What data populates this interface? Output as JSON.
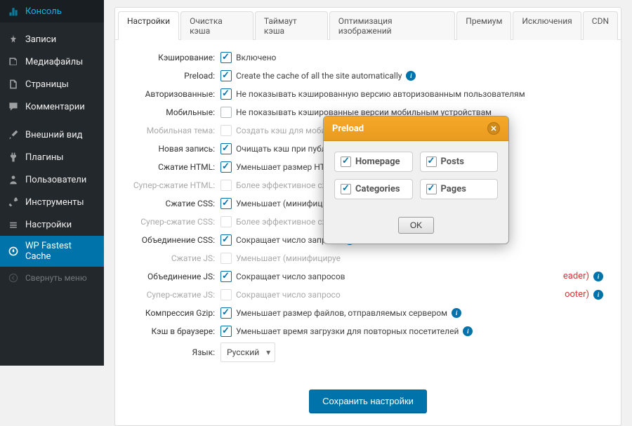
{
  "sidebar": {
    "items": [
      {
        "label": "Консоль",
        "icon": "dashboard"
      },
      {
        "label": "Записи",
        "icon": "pin"
      },
      {
        "label": "Медиафайлы",
        "icon": "media"
      },
      {
        "label": "Страницы",
        "icon": "page"
      },
      {
        "label": "Комментарии",
        "icon": "comment"
      },
      {
        "label": "Внешний вид",
        "icon": "appearance"
      },
      {
        "label": "Плагины",
        "icon": "plugin"
      },
      {
        "label": "Пользователи",
        "icon": "user"
      },
      {
        "label": "Инструменты",
        "icon": "tools"
      },
      {
        "label": "Настройки",
        "icon": "settings"
      },
      {
        "label": "WP Fastest Cache",
        "icon": "wpfc",
        "active": true
      }
    ],
    "collapse": "Свернуть меню"
  },
  "tabs": [
    "Настройки",
    "Очистка кэша",
    "Таймаут кэша",
    "Оптимизация изображений",
    "Премиум",
    "Исключения",
    "CDN"
  ],
  "settings": [
    {
      "key": "caching",
      "label": "Кэширование:",
      "checked": true,
      "desc": "Включено"
    },
    {
      "key": "preload",
      "label": "Preload:",
      "checked": true,
      "desc": "Create the cache of all the site automatically",
      "info": true
    },
    {
      "key": "loggedin",
      "label": "Авторизованные:",
      "checked": true,
      "desc": "Не показывать кэшированную версию авторизованным пользователям"
    },
    {
      "key": "mobile",
      "label": "Мобильные:",
      "checked": false,
      "desc": "Не показывать кэшированные версии мобильным устройствам"
    },
    {
      "key": "mobiletheme",
      "label": "Мобильная тема:",
      "checked": false,
      "desc": "Создать кэш для мобильной темы",
      "disabled": true
    },
    {
      "key": "newpost",
      "label": "Новая запись:",
      "checked": true,
      "desc": "Очищать кэш при публика"
    },
    {
      "key": "minifyhtml",
      "label": "Сжатие HTML:",
      "checked": true,
      "desc": "Уменьшает размер HTML-к"
    },
    {
      "key": "minifyhtmlplus",
      "label": "Супер-сжатие HTML:",
      "checked": false,
      "desc": "Более эффективное сжати",
      "disabled": true
    },
    {
      "key": "minifycss",
      "label": "Сжатие CSS:",
      "checked": true,
      "desc": "Уменьшает (минифицируе"
    },
    {
      "key": "minifycssplus",
      "label": "Супер-сжатие CSS:",
      "checked": false,
      "desc": "Более эффективное сжати",
      "disabled": true
    },
    {
      "key": "combinecss",
      "label": "Объединение CSS:",
      "checked": true,
      "desc": "Сокращает число запросо",
      "info": true
    },
    {
      "key": "minifyjs",
      "label": "Сжатие JS:",
      "checked": false,
      "desc": "Уменьшает (минифицируе",
      "disabled": true
    },
    {
      "key": "combinejs",
      "label": "Объединение JS:",
      "checked": true,
      "desc": "Сокращает число запросов",
      "warn": "eader)",
      "info": true
    },
    {
      "key": "combinejsplus",
      "label": "Супер-сжатие JS:",
      "checked": false,
      "desc": "Сокращает число запросо",
      "disabled": true,
      "warn": "ooter)",
      "info": true
    },
    {
      "key": "gzip",
      "label": "Компрессия Gzip:",
      "checked": true,
      "desc": "Уменьшает размер файлов, отправляемых сервером",
      "info": true
    },
    {
      "key": "browsercache",
      "label": "Кэш в браузере:",
      "checked": true,
      "desc": "Уменьшает время загрузки для повторных посетителей",
      "info": true
    }
  ],
  "lang": {
    "label": "Язык:",
    "value": "Русский"
  },
  "save": "Сохранить настройки",
  "modal": {
    "title": "Preload",
    "opts": [
      {
        "label": "Homepage",
        "checked": true
      },
      {
        "label": "Posts",
        "checked": true
      },
      {
        "label": "Categories",
        "checked": true
      },
      {
        "label": "Pages",
        "checked": true
      }
    ],
    "ok": "OK"
  }
}
